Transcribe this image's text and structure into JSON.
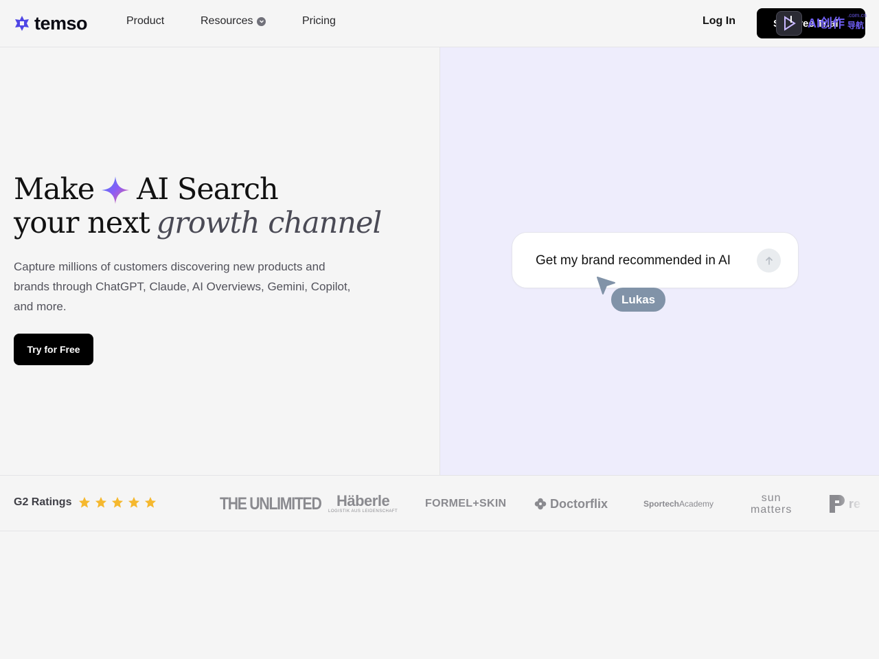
{
  "header": {
    "logo_text": "temso",
    "nav": {
      "product": "Product",
      "resources": "Resources",
      "pricing": "Pricing"
    },
    "login": "Log In",
    "cta_prefix": "S",
    "cta": "Free Trial"
  },
  "watermark": {
    "text": "AI创作",
    "sub": ".com.cn",
    "sub2": "导航"
  },
  "hero": {
    "headline_line1_a": "Make",
    "headline_line1_b": "AI Search",
    "headline_line2_a": "your next",
    "headline_line2_b": "growth channel",
    "subtext": "Capture millions of customers discovering new products and brands through ChatGPT, Claude, AI Overviews, Gemini, Copilot, and more.",
    "cta": "Try for Free"
  },
  "demo": {
    "prompt": "Get my brand recommended in AI",
    "cursor_name": "Lukas",
    "send_icon": "arrow-up-icon"
  },
  "ratings": {
    "label": "G2 Ratings",
    "stars": 5,
    "star_color": "#f5b82e"
  },
  "brands": {
    "b1": "THE UNLIMITED",
    "b2_main": "Häberle",
    "b2_small": "LOGISTIK AUS LEIDENSCHAFT",
    "b3": "FORMEL+SKIN",
    "b4": "Doctorflix",
    "b5_bold": "Sportech",
    "b5_light": "Academy",
    "b6_line1": "sun",
    "b6_line2": "matters",
    "b7": "re"
  },
  "colors": {
    "accent": "#4f46e5",
    "hero_right_bg": "#eeedfc",
    "cursor": "#8193a8"
  }
}
